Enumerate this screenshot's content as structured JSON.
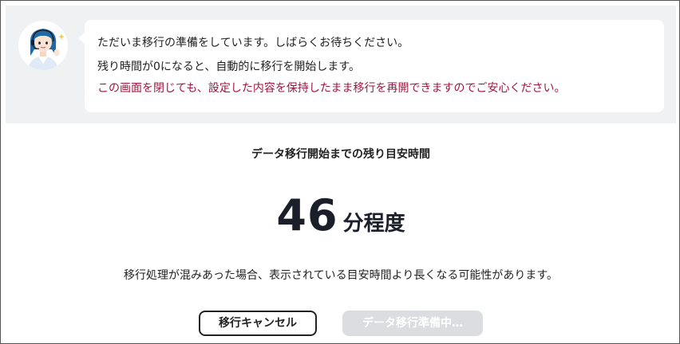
{
  "notice": {
    "line1": "ただいま移行の準備をしています。しばらくお待ちください。",
    "line2": "残り時間が0になると、自動的に移行を開始します。",
    "line3": "この画面を閉じても、設定した内容を保持したまま移行を再開できますのでご安心ください。"
  },
  "countdown": {
    "title": "データ移行開始までの残り目安時間",
    "value": "46",
    "unit": "分程度",
    "note": "移行処理が混みあった場合、表示されている目安時間より長くなる可能性があります。"
  },
  "buttons": {
    "cancel_label": "移行キャンセル",
    "preparing_label": "データ移行準備中…"
  },
  "colors": {
    "warning_text": "#a0163f",
    "panel_background": "#f0f1f3",
    "disabled_button": "#dcdde0"
  },
  "icons": {
    "avatar": "support-operator-avatar"
  }
}
